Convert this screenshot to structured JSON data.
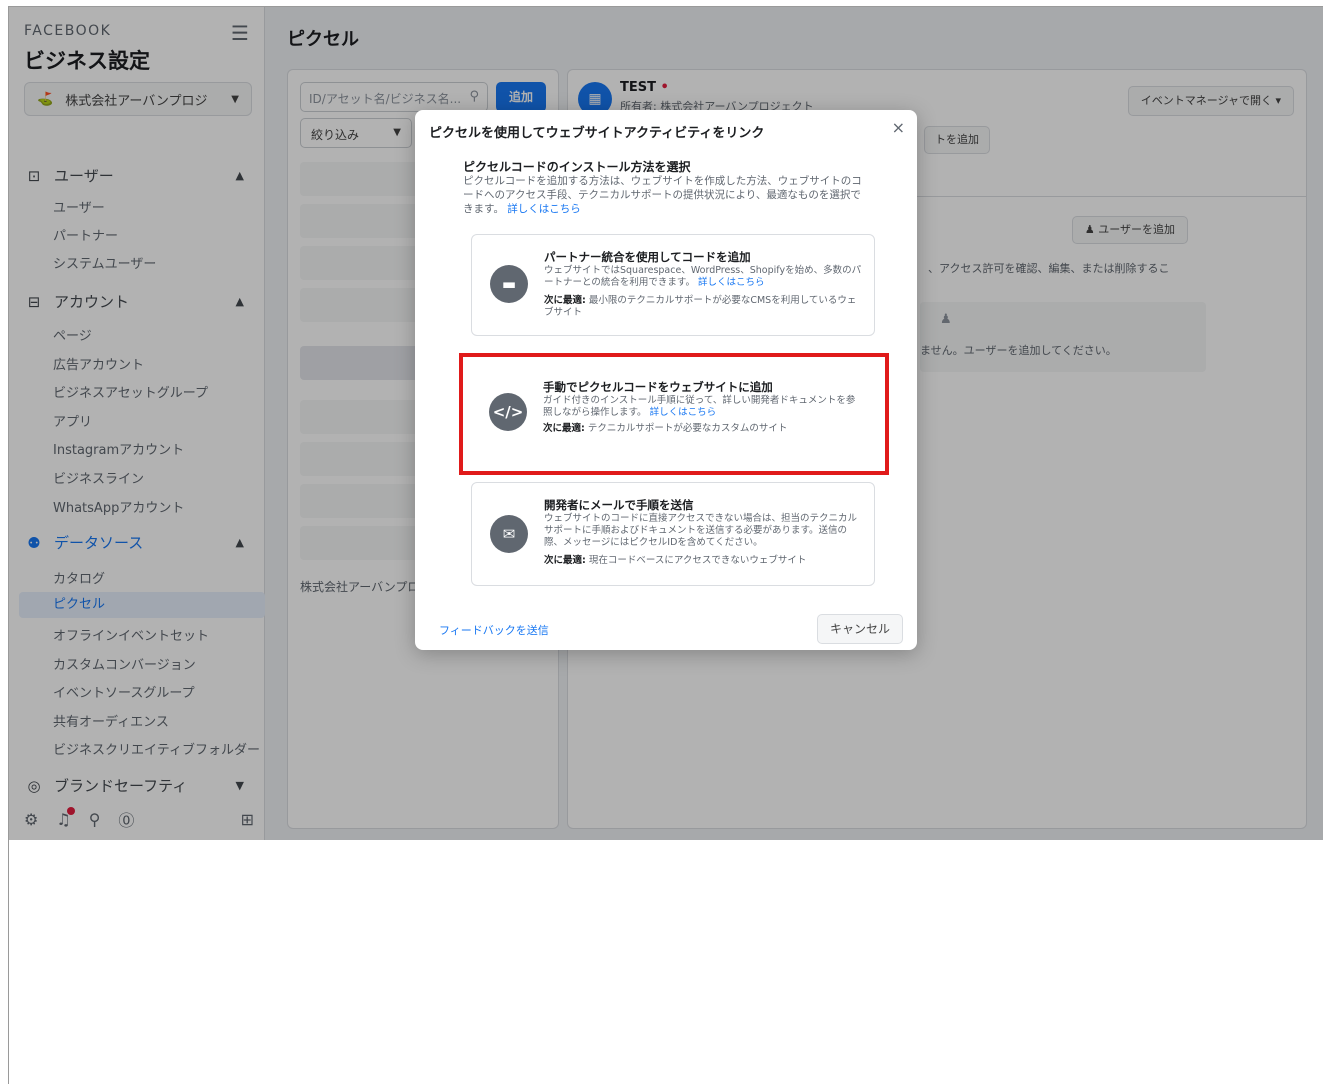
{
  "sidebar": {
    "brand_small": "FACEBOOK",
    "brand_big": "ビジネス設定",
    "business_name": "株式会社アーバンプロジ",
    "sections": {
      "users": {
        "label": "ユーザー",
        "items": [
          "ユーザー",
          "パートナー",
          "システムユーザー"
        ]
      },
      "accounts": {
        "label": "アカウント",
        "items": [
          "ページ",
          "広告アカウント",
          "ビジネスアセットグループ",
          "アプリ",
          "Instagramアカウント",
          "ビジネスライン",
          "WhatsAppアカウント"
        ]
      },
      "datasources": {
        "label": "データソース",
        "items": [
          "カタログ",
          "ピクセル",
          "オフラインイベントセット",
          "カスタムコンバージョン",
          "イベントソースグループ",
          "共有オーディエンス",
          "ビジネスクリエイティブフォルダー"
        ]
      },
      "brandsafety": {
        "label": "ブランドセーフティ"
      }
    }
  },
  "main": {
    "page_title": "ピクセル",
    "search_placeholder": "ID/アセット名/ビジネス名...",
    "add_button": "追加",
    "filter_label": "絞り込み",
    "list_owner_text": "株式会社アーバンプロ",
    "pixel_avatar": "▦",
    "pixel_name": "TEST",
    "pixel_owner": "所有者: 株式会社アーバンプロジェクト",
    "open_event_manager": "イベントマネージャで開く",
    "add_asset_button": "トを追加",
    "add_user_button": "ユーザーを追加",
    "permission_text": "、アクセス許可を確認、編集、または削除するこ",
    "empty_text": "ません。ユーザーを追加してください。"
  },
  "modal": {
    "title": "ピクセルを使用してウェブサイトアクティビティをリンク",
    "heading": "ピクセルコードのインストール方法を選択",
    "desc": "ピクセルコードを追加する方法は、ウェブサイトを作成した方法、ウェブサイトのコードへのアクセス手段、テクニカルサポートの提供状況により、最適なものを選択できます。",
    "desc_link": "詳しくはこちら",
    "options": [
      {
        "icon": "briefcase-icon",
        "title": "パートナー統合を使用してコードを追加",
        "desc": "ウェブサイトではSquarespace、WordPress、Shopifyを始め、多数のパートナーとの統合を利用できます。",
        "link": "詳しくはこちら",
        "rec_label": "次に最適:",
        "rec": "最小限のテクニカルサポートが必要なCMSを利用しているウェブサイト"
      },
      {
        "icon": "code-icon",
        "title": "手動でピクセルコードをウェブサイトに追加",
        "desc": "ガイド付きのインストール手順に従って、詳しい開発者ドキュメントを参照しながら操作します。",
        "link": "詳しくはこちら",
        "rec_label": "次に最適:",
        "rec": "テクニカルサポートが必要なカスタムのサイト"
      },
      {
        "icon": "email-icon",
        "title": "開発者にメールで手順を送信",
        "desc": "ウェブサイトのコードに直接アクセスできない場合は、担当のテクニカルサポートに手順およびドキュメントを送信する必要があります。送信の際、メッセージにはピクセルIDを含めてください。",
        "link": "",
        "rec_label": "次に最適:",
        "rec": "現在コードベースにアクセスできないウェブサイト"
      }
    ],
    "feedback_link": "フィードバックを送信",
    "cancel_button": "キャンセル"
  },
  "colors": {
    "accent": "#1877f2",
    "highlight": "#e01a1a",
    "notification": "#e41e3f"
  }
}
